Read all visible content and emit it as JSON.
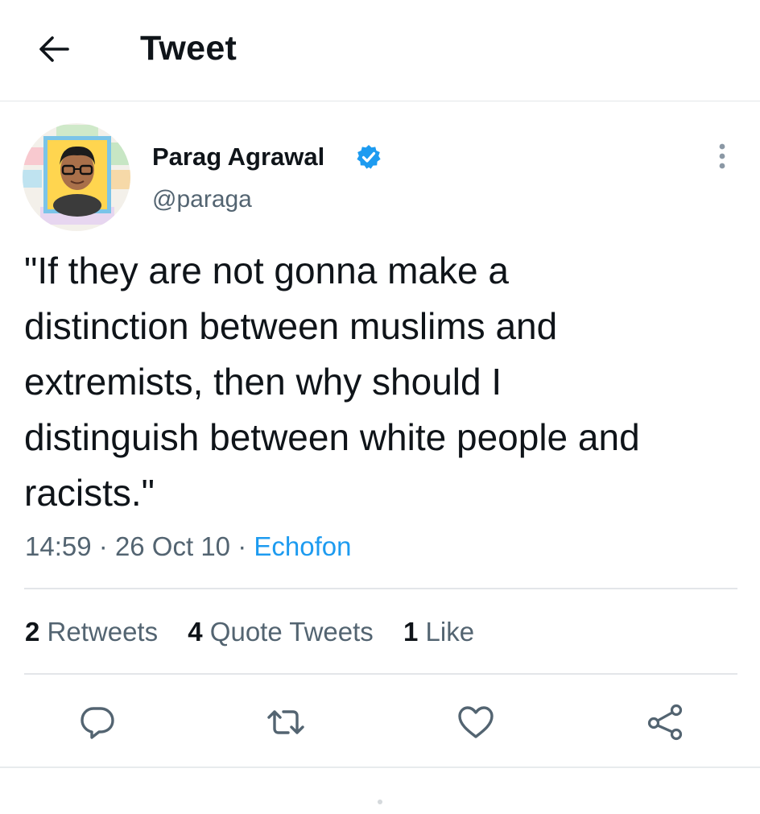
{
  "header": {
    "title": "Tweet",
    "back_icon": "arrow-left-icon"
  },
  "author": {
    "name": "Parag Agrawal",
    "handle": "@paraga",
    "verified": true,
    "verified_color": "#1d9bf0"
  },
  "tweet": {
    "text": "\"If they are not gonna make a\ndistinction between muslims and\nextremists, then why should I\ndistinguish between white people and\nracists.\"",
    "time": "14:59",
    "date": "26 Oct 10",
    "separator": "·",
    "source": "Echofon"
  },
  "stats": {
    "retweets_count": "2",
    "retweets_label": "Retweets",
    "quotes_count": "4",
    "quotes_label": "Quote Tweets",
    "likes_count": "1",
    "likes_label": "Like"
  },
  "actions": [
    "reply-icon",
    "retweet-icon",
    "like-icon",
    "share-icon"
  ],
  "colors": {
    "accent": "#1d9bf0",
    "text_primary": "#0f1419",
    "text_secondary": "#536471",
    "divider": "#e3e6e9"
  }
}
